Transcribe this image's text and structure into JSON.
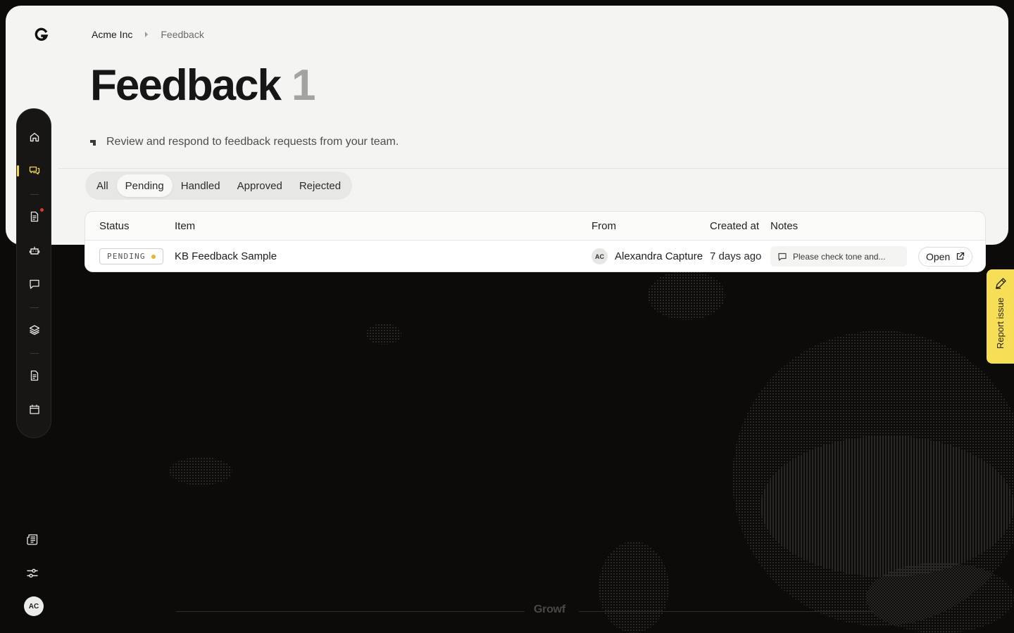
{
  "breadcrumb": {
    "org": "Acme Inc",
    "current": "Feedback"
  },
  "page": {
    "title": "Feedback",
    "count": "1",
    "description": "Review and respond to feedback requests from your team."
  },
  "filters": {
    "active": "Pending",
    "tabs": [
      "All",
      "Pending",
      "Handled",
      "Approved",
      "Rejected"
    ]
  },
  "table": {
    "headers": {
      "status": "Status",
      "item": "Item",
      "from": "From",
      "created": "Created at",
      "notes": "Notes"
    },
    "rows": [
      {
        "status": "PENDING",
        "item": "KB Feedback Sample",
        "from_initials": "AC",
        "from_name": "Alexandra Capture",
        "created": "7 days ago",
        "note": "Please check tone and...",
        "action": "Open"
      }
    ]
  },
  "sidebar": {
    "items": [
      "home-icon",
      "feedback-icon",
      "document-icon",
      "bot-icon",
      "chat-icon",
      "layers-icon",
      "file-icon",
      "calendar-icon"
    ],
    "bottom": [
      "news-icon",
      "settings-icon"
    ],
    "user_initials": "AC"
  },
  "report": {
    "label": "Report issue"
  },
  "footer": {
    "brand": "Growf"
  },
  "colors": {
    "accent": "#f2d54a",
    "pending": "#e8b62a",
    "notification": "#e0372f"
  }
}
